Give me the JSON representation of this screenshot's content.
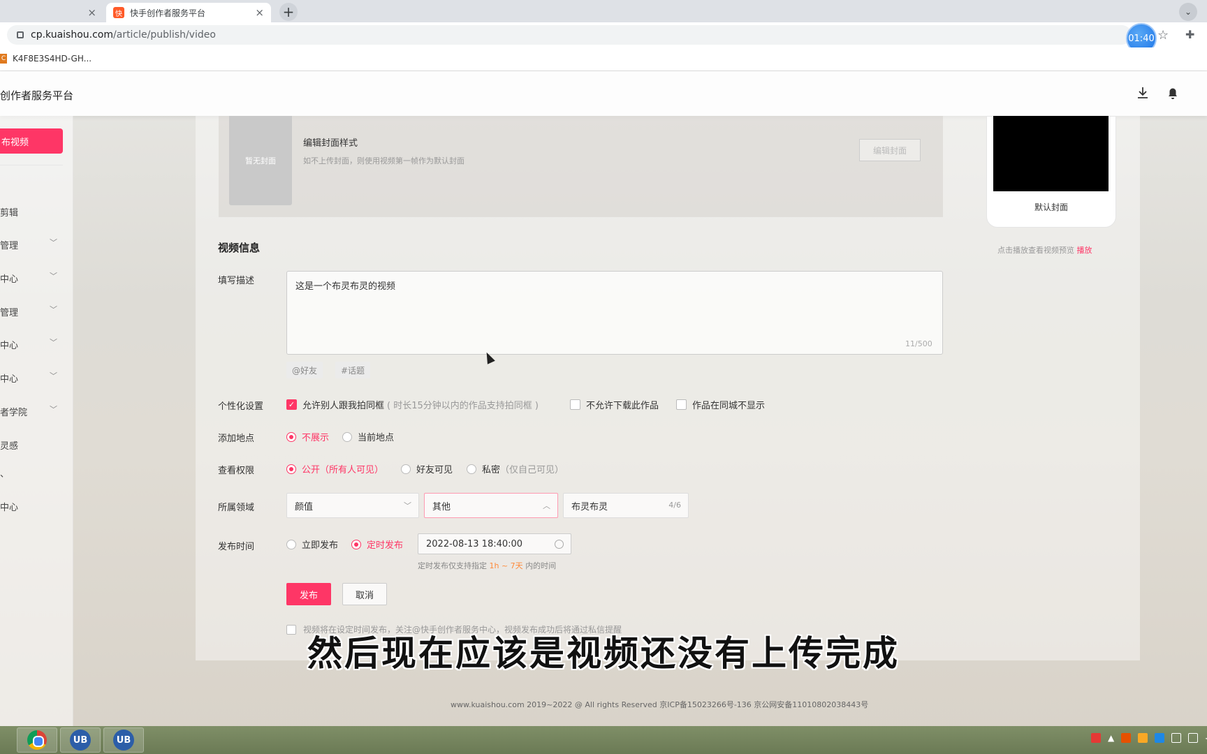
{
  "browser": {
    "active_tab_title": "快手创作者服务平台",
    "tab_close": "×",
    "new_tab": "+",
    "url_domain": "cp.kuaishou.com",
    "url_path": "/article/publish/video",
    "timer": "01:40",
    "bookmark": "K4F8E3S4HD-GH..."
  },
  "site": {
    "title": "创作者服务平台"
  },
  "sidebar": {
    "publish_label": "布视频",
    "items": [
      {
        "label": "剪辑",
        "has_chevron": false
      },
      {
        "label": "管理",
        "has_chevron": true
      },
      {
        "label": "中心",
        "has_chevron": true
      },
      {
        "label": "管理",
        "has_chevron": true
      },
      {
        "label": "中心",
        "has_chevron": true
      },
      {
        "label": "中心",
        "has_chevron": true
      },
      {
        "label": "者学院",
        "has_chevron": true
      },
      {
        "label": "灵感",
        "has_chevron": false
      },
      {
        "label": "、",
        "has_chevron": false
      },
      {
        "label": "中心",
        "has_chevron": false
      }
    ]
  },
  "cover": {
    "placeholder": "暂无封面",
    "title": "编辑封面样式",
    "hint": "如不上传封面，则使用视频第一帧作为默认封面",
    "edit_button": "编辑封面",
    "default_cover_label": "默认封面",
    "preview_hint": "点击播放查看视频预览",
    "preview_link": "播放"
  },
  "form": {
    "section_title": "视频信息",
    "desc_label": "填写描述",
    "desc_value": "这是一个布灵布灵的视频",
    "desc_count": "11/500",
    "mention_chip": "@好友",
    "topic_chip": "#话题",
    "personal_label": "个性化设置",
    "allow_frame": "允许别人跟我拍同框",
    "allow_frame_hint": "( 时长15分钟以内的作品支持拍同框 )",
    "no_download": "不允许下载此作品",
    "hide_local": "作品在同城不显示",
    "location_label": "添加地点",
    "loc_hide": "不展示",
    "loc_current": "当前地点",
    "perm_label": "查看权限",
    "perm_public": "公开（所有人可见）",
    "perm_friends": "好友可见",
    "perm_private": "私密",
    "perm_private_hint": "（仅自己可见）",
    "domain_label": "所属领域",
    "domain_sel1": "颜值",
    "domain_sel2": "其他",
    "domain_input": "布灵布灵",
    "domain_count": "4/6",
    "time_label": "发布时间",
    "time_now": "立即发布",
    "time_sched": "定时发布",
    "datetime": "2022-08-13 18:40:00",
    "time_hint_pre": "定时发布仅支持指定",
    "time_hint_range": "1h ~ 7天",
    "time_hint_post": "内的时间",
    "publish_button": "发布",
    "cancel_button": "取消",
    "notice": "视频将在设定时间发布，关注@快手创作者服务中心，视频发布成功后将通过私信提醒"
  },
  "subtitle": "然后现在应该是视频还没有上传完成",
  "footer": "www.kuaishou.com 2019~2022 @ All rights Reserved 京ICP备15023266号-136  京公网安备11010802038443号",
  "colors": {
    "accent": "#fe3666",
    "orange": "#fe8a3a"
  }
}
